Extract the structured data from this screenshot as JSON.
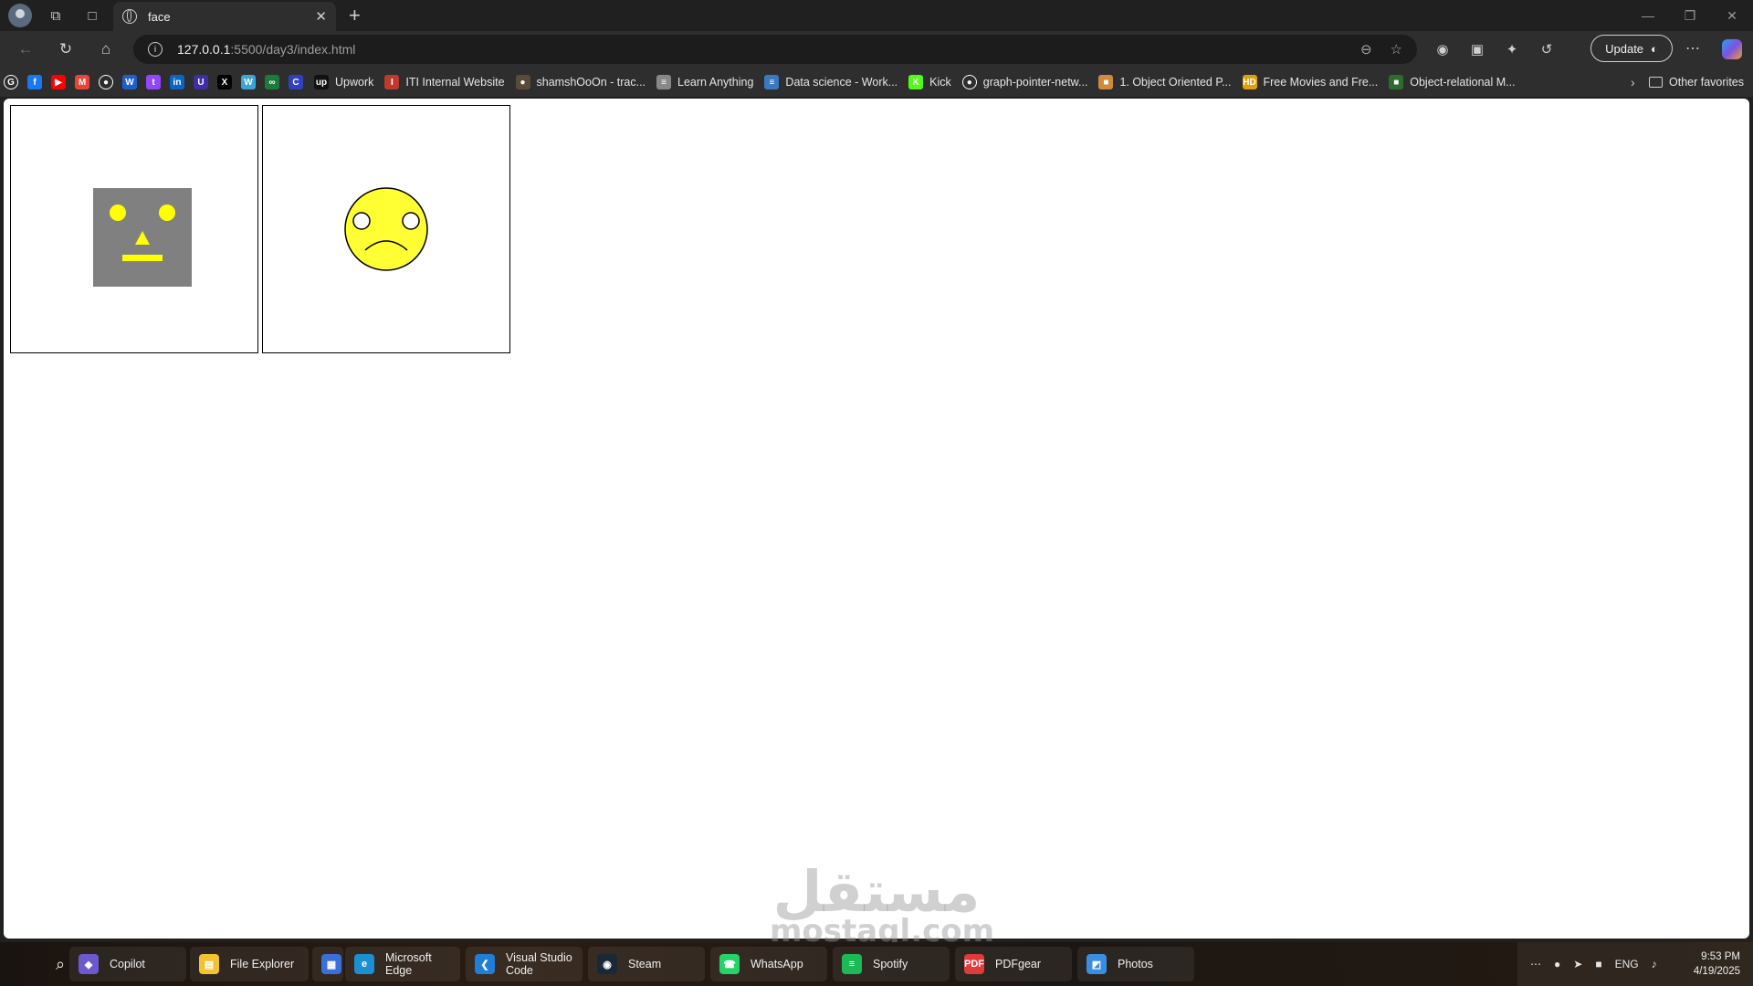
{
  "browser": {
    "tab_title": "face",
    "url_host": "127.0.0.1",
    "url_rest": ":5500/day3/index.html",
    "update_label": "Update"
  },
  "favorites": [
    {
      "icon": "google-icon",
      "label": "",
      "color": "#ffffff"
    },
    {
      "icon": "facebook-icon",
      "label": "",
      "color": "#1877f2"
    },
    {
      "icon": "youtube-icon",
      "label": "",
      "color": "#ff0000"
    },
    {
      "icon": "gmail-icon",
      "label": "",
      "color": "#ea4335"
    },
    {
      "icon": "github-icon",
      "label": "",
      "color": "#ffffff"
    },
    {
      "icon": "w-icon",
      "label": "",
      "color": "#1b5fd1"
    },
    {
      "icon": "twitch-icon",
      "label": "",
      "color": "#9146ff"
    },
    {
      "icon": "linkedin-icon",
      "label": "",
      "color": "#0a66c2"
    },
    {
      "icon": "u-icon",
      "label": "",
      "color": "#3c2fa8"
    },
    {
      "icon": "x-icon",
      "label": "",
      "color": "#000000"
    },
    {
      "icon": "w2-icon",
      "label": "",
      "color": "#3aa6d8"
    },
    {
      "icon": "infinity-icon",
      "label": "",
      "color": "#1e7a3a"
    },
    {
      "icon": "c-icon",
      "label": "",
      "color": "#3040c0"
    },
    {
      "icon": "upwork-icon",
      "label": "Upwork",
      "color": "#111111"
    },
    {
      "icon": "iti-icon",
      "label": "ITI Internal Website",
      "color": "#c0392b"
    },
    {
      "icon": "person-icon",
      "label": "shamshOoOn - trac...",
      "color": "#5a4a3a"
    },
    {
      "icon": "stack-icon",
      "label": "Learn Anything",
      "color": "#888888"
    },
    {
      "icon": "notebook-icon",
      "label": "Data science - Work...",
      "color": "#3a78c0"
    },
    {
      "icon": "kick-icon",
      "label": "Kick",
      "color": "#53fc18"
    },
    {
      "icon": "github-icon",
      "label": "graph-pointer-netw...",
      "color": "#ffffff"
    },
    {
      "icon": "book-icon",
      "label": "1. Object Oriented P...",
      "color": "#d08a3a"
    },
    {
      "icon": "hd-icon",
      "label": "Free Movies and Fre...",
      "color": "#e0a000"
    },
    {
      "icon": "orm-icon",
      "label": "Object-relational M...",
      "color": "#2e6b2e"
    }
  ],
  "other_favorites": "Other favorites",
  "page": {
    "colors": {
      "robot_face": "#808080",
      "features": "#ffff00",
      "border": "#000000"
    }
  },
  "watermark": {
    "arabic": "مستقل",
    "latin": "mostaql.com"
  },
  "taskbar": {
    "items": [
      {
        "label": "Copilot",
        "icon": "copilot-icon",
        "color": "#6a5acd"
      },
      {
        "label": "File Explorer",
        "icon": "folder-icon",
        "color": "#f2c230"
      },
      {
        "label": "",
        "icon": "store-icon",
        "color": "#3a6fd8"
      },
      {
        "label": "Microsoft Edge",
        "icon": "edge-icon",
        "color": "#1b8fd0"
      },
      {
        "label": "Visual Studio Code",
        "icon": "vscode-icon",
        "color": "#1f7ed6"
      },
      {
        "label": "Steam",
        "icon": "steam-icon",
        "color": "#1b2838"
      },
      {
        "label": "WhatsApp",
        "icon": "whatsapp-icon",
        "color": "#25d366"
      },
      {
        "label": "Spotify",
        "icon": "spotify-icon",
        "color": "#1db954"
      },
      {
        "label": "PDFgear",
        "icon": "pdfgear-icon",
        "color": "#e03a3a"
      },
      {
        "label": "Photos",
        "icon": "photos-icon",
        "color": "#3a8ee0"
      }
    ],
    "lang": "ENG",
    "time": "9:53 PM",
    "date": "4/19/2025"
  }
}
